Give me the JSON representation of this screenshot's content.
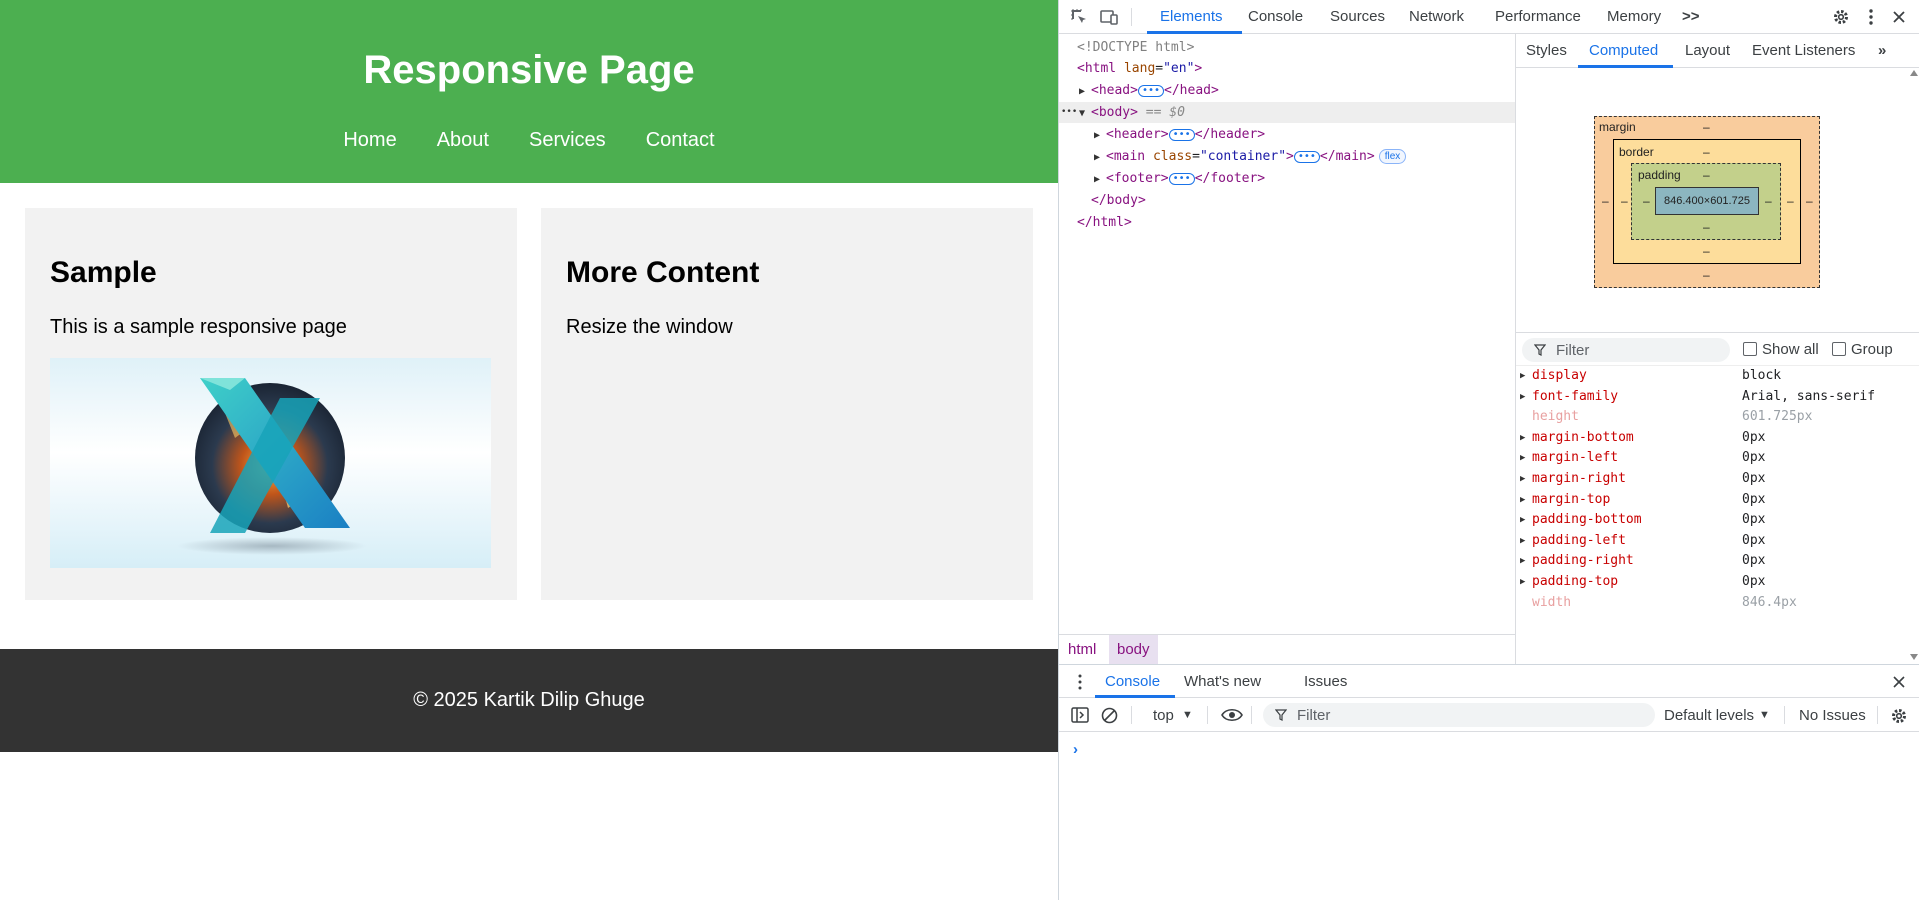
{
  "page": {
    "title": "Responsive Page",
    "nav": [
      "Home",
      "About",
      "Services",
      "Contact"
    ],
    "cards": [
      {
        "heading": "Sample",
        "text": "This is a sample responsive page"
      },
      {
        "heading": "More Content",
        "text": "Resize the window"
      }
    ],
    "footer": "© 2025 Kartik Dilip Ghuge",
    "colors": {
      "header_bg": "#4caf50",
      "card_bg": "#f2f2f2",
      "footer_bg": "#333333"
    }
  },
  "devtools": {
    "tabs": [
      "Elements",
      "Console",
      "Sources",
      "Network",
      "Performance",
      "Memory"
    ],
    "active_tab": "Elements",
    "more_tabs": ">>",
    "dom": {
      "doctype": "<!DOCTYPE html>",
      "html_open_tag": "<html",
      "lang_attr": "lang",
      "lang_value": "\"en\"",
      "gt": ">",
      "head_open": "<head>",
      "head_close": "</head>",
      "body_open": "<body>",
      "body_selected": "== $0",
      "header_open": "<header>",
      "header_close": "</header>",
      "main_open": "<main",
      "main_attr": "class",
      "main_value": "\"container\"",
      "main_close": "</main>",
      "flex_badge": "flex",
      "footer_open": "<footer>",
      "footer_close": "</footer>",
      "body_close": "</body>",
      "html_close": "</html>",
      "ellipsis": "•••",
      "line_dots": "•••"
    },
    "breadcrumbs": [
      "html",
      "body"
    ],
    "side_tabs": [
      "Styles",
      "Computed",
      "Layout",
      "Event Listeners"
    ],
    "active_side_tab": "Computed",
    "box_model": {
      "margin_label": "margin",
      "border_label": "border",
      "padding_label": "padding",
      "content_size": "846.400×601.725",
      "dash": "–"
    },
    "filter_placeholder": "Filter",
    "show_all": "Show all",
    "group": "Group",
    "computed_props": [
      {
        "name": "display",
        "value": "block",
        "expandable": true,
        "dim": false
      },
      {
        "name": "font-family",
        "value": "Arial, sans-serif",
        "expandable": true,
        "dim": false
      },
      {
        "name": "height",
        "value": "601.725px",
        "expandable": false,
        "dim": true
      },
      {
        "name": "margin-bottom",
        "value": "0px",
        "expandable": true,
        "dim": false
      },
      {
        "name": "margin-left",
        "value": "0px",
        "expandable": true,
        "dim": false
      },
      {
        "name": "margin-right",
        "value": "0px",
        "expandable": true,
        "dim": false
      },
      {
        "name": "margin-top",
        "value": "0px",
        "expandable": true,
        "dim": false
      },
      {
        "name": "padding-bottom",
        "value": "0px",
        "expandable": true,
        "dim": false
      },
      {
        "name": "padding-left",
        "value": "0px",
        "expandable": true,
        "dim": false
      },
      {
        "name": "padding-right",
        "value": "0px",
        "expandable": true,
        "dim": false
      },
      {
        "name": "padding-top",
        "value": "0px",
        "expandable": true,
        "dim": false
      },
      {
        "name": "width",
        "value": "846.4px",
        "expandable": false,
        "dim": true
      }
    ],
    "drawer": {
      "tabs": [
        "Console",
        "What's new",
        "Issues"
      ],
      "active_tab": "Console",
      "context": "top",
      "filter_placeholder": "Filter",
      "levels": "Default levels",
      "issues": "No Issues",
      "prompt": "›"
    }
  }
}
